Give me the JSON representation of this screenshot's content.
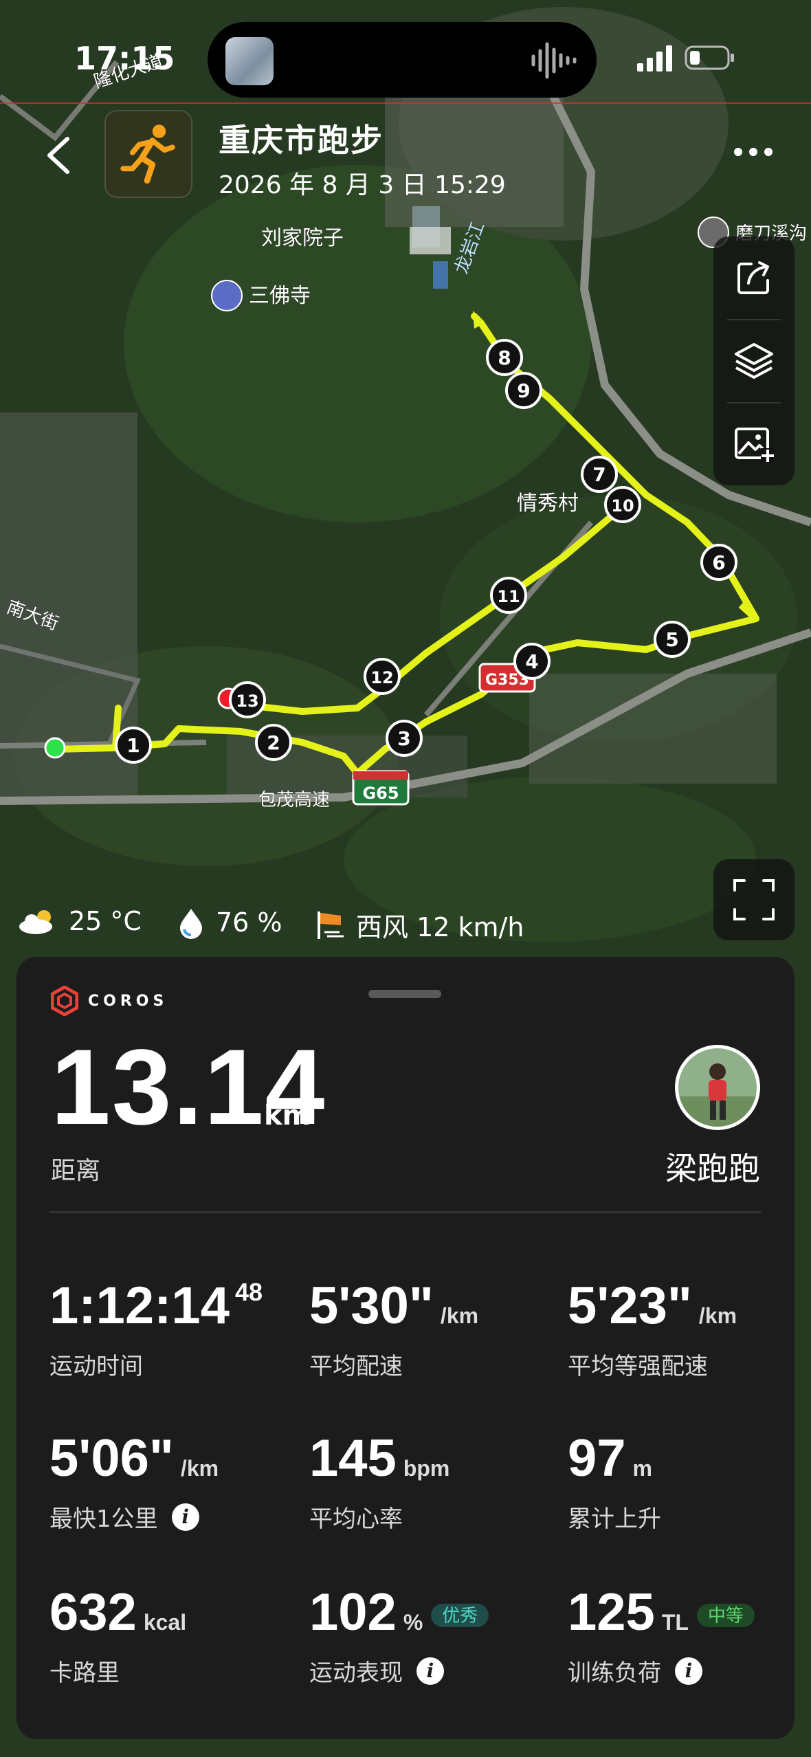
{
  "status_bar": {
    "time": "17:15"
  },
  "header": {
    "title": "重庆市跑步",
    "datetime": "2026 年 8 月 3 日 15:29"
  },
  "map": {
    "labels": {
      "road_longhuadadao": "隆化大道",
      "liujia": "刘家院子",
      "sanfosi": "三佛寺",
      "qingxiu": "情秀村",
      "nandajie": "南大街",
      "baomao": "包茂高速",
      "longyanjiang": "龙岩江",
      "modaoxi": "磨刀溪沟"
    },
    "highway_shields": {
      "g65": "G65",
      "g353": "G353"
    },
    "splits": [
      "1",
      "2",
      "3",
      "4",
      "5",
      "6",
      "7",
      "8",
      "9",
      "10",
      "11",
      "12",
      "13"
    ]
  },
  "weather": {
    "temperature": "25 °C",
    "humidity": "76 %",
    "wind": "西风 12 km/h"
  },
  "summary": {
    "brand": "COROS",
    "distance_value": "13.14",
    "distance_unit": "km",
    "distance_label": "距离",
    "user_name": "梁跑跑"
  },
  "metrics": {
    "duration": {
      "value": "1:12:14",
      "sup": "48",
      "label": "运动时间"
    },
    "avg_pace": {
      "value": "5'30\"",
      "unit": "/km",
      "label": "平均配速"
    },
    "avg_grade_pace": {
      "value": "5'23\"",
      "unit": "/km",
      "label": "平均等强配速"
    },
    "fastest_km": {
      "value": "5'06\"",
      "unit": "/km",
      "label": "最快1公里"
    },
    "avg_hr": {
      "value": "145",
      "unit": "bpm",
      "label": "平均心率"
    },
    "ascent": {
      "value": "97",
      "unit": "m",
      "label": "累计上升"
    },
    "calories": {
      "value": "632",
      "unit": "kcal",
      "label": "卡路里"
    },
    "performance": {
      "value": "102",
      "unit": "%",
      "badge": "优秀",
      "label": "运动表现"
    },
    "training_load": {
      "value": "125",
      "unit": "TL",
      "badge": "中等",
      "label": "训练负荷"
    }
  },
  "colors": {
    "route": "#e4f21a",
    "start": "#2ee04a",
    "end": "#e8202a",
    "sheet": "#1c1c1c",
    "badge_excellent": "#4ed6c6",
    "badge_medium": "#5ad36b"
  }
}
